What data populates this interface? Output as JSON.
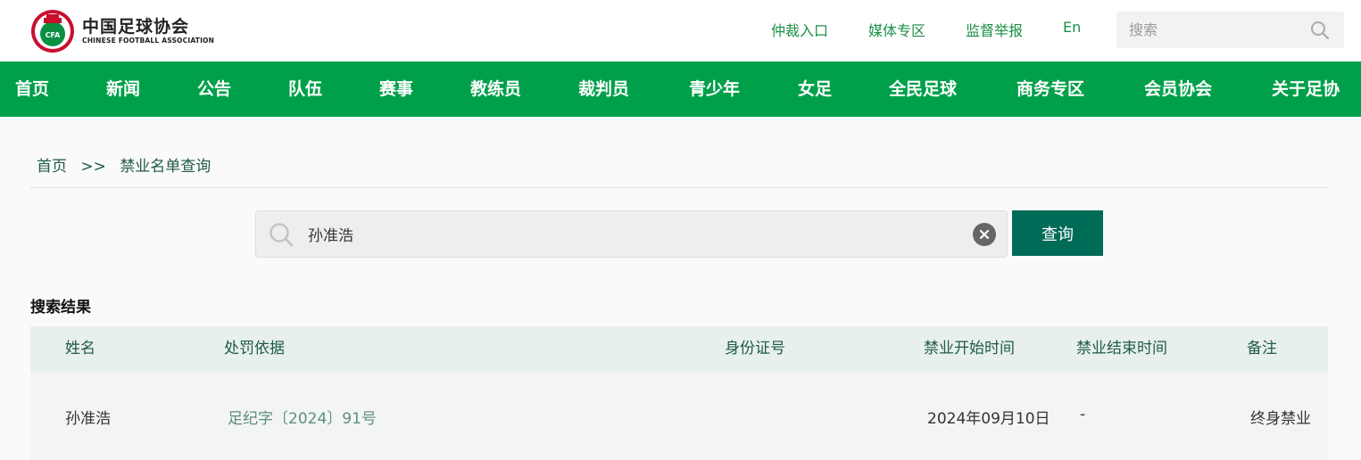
{
  "brand": {
    "name_cn": "中国足球协会",
    "name_en": "CHINESE FOOTBALL ASSOCIATION",
    "emblem_text": "CFA"
  },
  "header": {
    "links": [
      "仲裁入口",
      "媒体专区",
      "监督举报",
      "En"
    ],
    "search_placeholder": "搜索"
  },
  "nav": {
    "items": [
      "首页",
      "新闻",
      "公告",
      "队伍",
      "赛事",
      "教练员",
      "裁判员",
      "青少年",
      "女足",
      "全民足球",
      "商务专区",
      "会员协会",
      "关于足协"
    ]
  },
  "breadcrumb": {
    "home": "首页",
    "separator": ">>",
    "current": "禁业名单查询"
  },
  "search": {
    "value": "孙准浩",
    "button_label": "查询"
  },
  "results": {
    "title": "搜索结果",
    "columns": [
      "姓名",
      "处罚依据",
      "身份证号",
      "禁业开始时间",
      "禁业结束时间",
      "备注"
    ],
    "rows": [
      {
        "name": "孙准浩",
        "basis": "足纪字〔2024〕91号",
        "id_number": "",
        "start": "2024年09月10日",
        "end": "-",
        "note": "终身禁业"
      }
    ]
  },
  "colors": {
    "nav_green": "#00a04a",
    "button_green": "#006b57",
    "link_green": "#1b8f47"
  }
}
